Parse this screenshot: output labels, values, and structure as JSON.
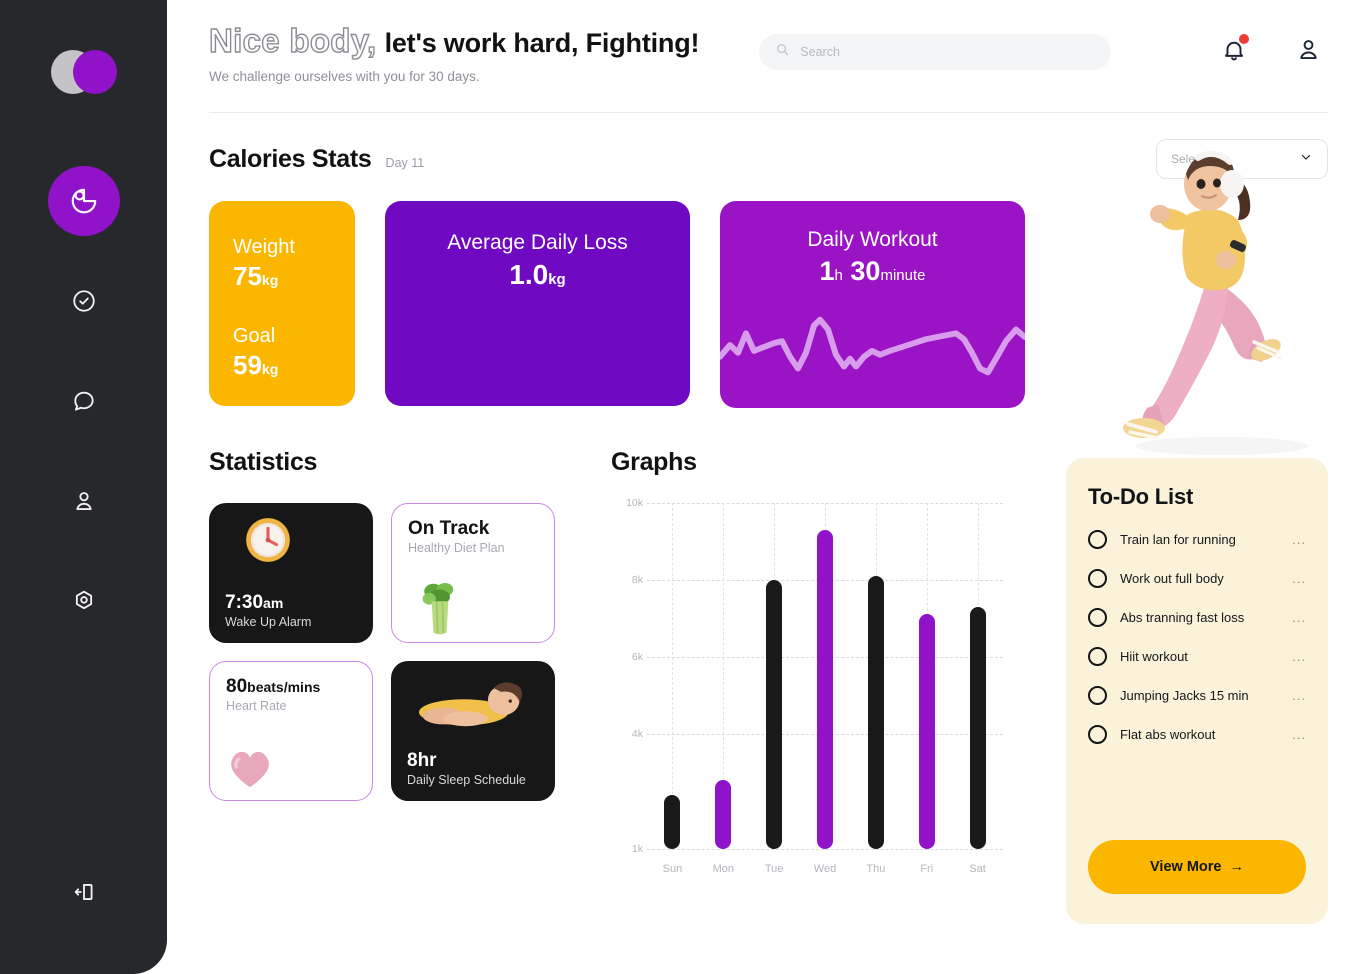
{
  "sidebar": {
    "logo_name": "app-logo",
    "items": [
      {
        "icon": "pie-chart-icon",
        "name": "dashboard",
        "active": true
      },
      {
        "icon": "check-circle-icon",
        "name": "tasks",
        "active": false
      },
      {
        "icon": "chat-bubble-icon",
        "name": "messages",
        "active": false
      },
      {
        "icon": "user-icon",
        "name": "profile",
        "active": false
      },
      {
        "icon": "settings-gear-icon",
        "name": "settings",
        "active": false
      }
    ],
    "logout_icon": "logout-icon"
  },
  "header": {
    "title_outline": "Nice body,",
    "title_solid": "let's work hard, Fighting!",
    "subtitle": "We challenge ourselves with you for 30 days.",
    "search_placeholder": "Search",
    "search_value": "",
    "search_icon": "search-icon",
    "bell_icon": "bell-icon",
    "has_notification": true,
    "account_icon": "account-icon"
  },
  "calories": {
    "section_title": "Calories Stats",
    "section_sub": "Day 11",
    "select_day_label": "Select Day",
    "cards": {
      "weight": {
        "label1": "Weight",
        "value1": "75",
        "unit1": "kg",
        "label2": "Goal",
        "value2": "59",
        "unit2": "kg",
        "color": "#fbb700"
      },
      "loss": {
        "label": "Average Daily Loss",
        "value": "1.0",
        "unit": "kg",
        "color": "#7009c2"
      },
      "workout": {
        "label": "Daily Workout",
        "value_hours": "1",
        "unit_hours": "h",
        "value_minutes": "30",
        "unit_minutes": "minute",
        "color": "#9a13c4"
      }
    }
  },
  "statistics": {
    "section_title": "Statistics",
    "cards": [
      {
        "name": "wake-up-alarm",
        "value": "7:30",
        "value_suffix": "am",
        "caption": "Wake Up Alarm",
        "theme": "dark",
        "art": "alarm-clock-icon"
      },
      {
        "name": "diet-plan",
        "value": "On Track",
        "value_suffix": "",
        "caption": "Healthy Diet Plan",
        "theme": "light",
        "art": "celery-icon"
      },
      {
        "name": "heart-rate",
        "value": "80",
        "value_suffix": "beats/mins",
        "caption": "Heart Rate",
        "theme": "light",
        "art": "heart-icon"
      },
      {
        "name": "sleep-schedule",
        "value": "8hr",
        "value_suffix": "",
        "caption": "Daily Sleep Schedule",
        "theme": "dark",
        "art": "sleeping-person-icon"
      }
    ]
  },
  "graphs": {
    "section_title": "Graphs"
  },
  "chart_data": {
    "type": "bar",
    "title": "Graphs",
    "xlabel": "",
    "ylabel": "",
    "categories": [
      "Sun",
      "Mon",
      "Tue",
      "Wed",
      "Thu",
      "Fri",
      "Sat"
    ],
    "values": [
      2400,
      2800,
      8000,
      9300,
      8100,
      7100,
      7300
    ],
    "bar_colors": [
      "#1a1a1a",
      "#9012c9",
      "#1a1a1a",
      "#9012c9",
      "#1a1a1a",
      "#9012c9",
      "#1a1a1a"
    ],
    "ylim": [
      1000,
      10000
    ],
    "yticks": [
      1000,
      4000,
      6000,
      8000,
      10000
    ],
    "ytick_labels": [
      "1k",
      "4k",
      "6k",
      "8k",
      "10k"
    ],
    "grid": true,
    "legend": "none"
  },
  "todo": {
    "title": "To-Do List",
    "items": [
      {
        "label": "Train lan for running",
        "checked": false,
        "menu": "..."
      },
      {
        "label": "Work out full body",
        "checked": false,
        "menu": "..."
      },
      {
        "label": "Abs tranning fast loss",
        "checked": false,
        "menu": "..."
      },
      {
        "label": "Hiit workout",
        "checked": false,
        "menu": "..."
      },
      {
        "label": "Jumping Jacks 15 min",
        "checked": false,
        "menu": "..."
      },
      {
        "label": "Flat abs workout",
        "checked": false,
        "menu": "..."
      }
    ],
    "button_label": "View More",
    "button_arrow": "→"
  },
  "illustration": {
    "name": "running-woman-illustration"
  },
  "colors": {
    "accent_purple": "#9012c9",
    "deep_purple": "#7009c2",
    "magenta_purple": "#9a13c4",
    "accent_yellow": "#fbb700",
    "sidebar_dark": "#26282b",
    "card_dark": "#171717",
    "todo_cream": "#fbf3d9",
    "notification_red": "#ef3b36"
  }
}
